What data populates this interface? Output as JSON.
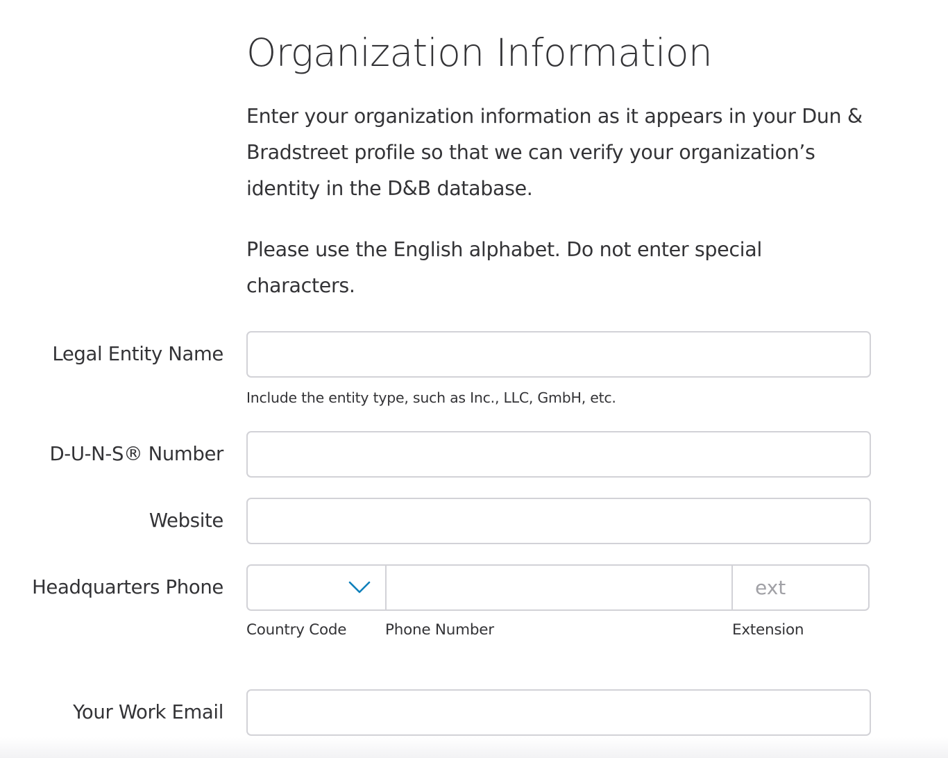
{
  "page": {
    "title": "Organization Information",
    "intro_paragraph": "Enter your organization information as it appears in your Dun & Bradstreet profile so that we can verify your organization’s identity in the D&B database.",
    "alphabet_note": "Please use the English alphabet. Do not enter special characters."
  },
  "form": {
    "legal_entity": {
      "label": "Legal Entity Name",
      "value": "",
      "help": "Include the entity type, such as Inc., LLC, GmbH, etc."
    },
    "duns": {
      "label": "D-U-N-S® Number",
      "value": ""
    },
    "website": {
      "label": "Website",
      "value": ""
    },
    "hq_phone": {
      "label": "Headquarters Phone",
      "country_code_value": "",
      "country_code_label": "Country Code",
      "phone_number_value": "",
      "phone_number_label": "Phone Number",
      "extension_placeholder": "ext",
      "extension_value": "",
      "extension_label": "Extension",
      "dropdown_icon": "chevron-down-icon",
      "dropdown_icon_color": "#0f80bb"
    },
    "work_email": {
      "label": "Your Work Email",
      "value": ""
    }
  }
}
